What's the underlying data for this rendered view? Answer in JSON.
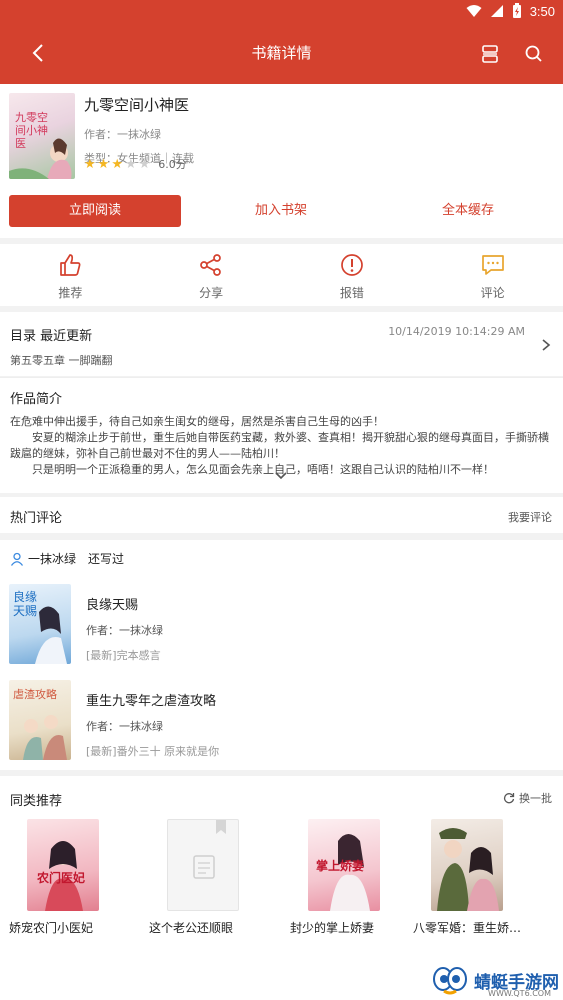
{
  "status_bar": {
    "time": "3:50"
  },
  "header": {
    "title": "书籍详情"
  },
  "book": {
    "title": "九零空间小神医",
    "author": "作者：一抹冰绿",
    "category": "类型：女生频道｜连载",
    "rating": {
      "filled": 3,
      "total": 5
    },
    "score": "6.0分",
    "cover_text": "九零空间小神医"
  },
  "buttons": {
    "read": "立即阅读",
    "add_shelf": "加入书架",
    "cache_all": "全本缓存"
  },
  "actions": [
    {
      "label": "推荐",
      "icon": "thumbs-up-icon"
    },
    {
      "label": "分享",
      "icon": "share-icon"
    },
    {
      "label": "报错",
      "icon": "error-icon"
    },
    {
      "label": "评论",
      "icon": "comment-icon"
    }
  ],
  "catalog": {
    "label": "目录  最近更新",
    "date": "10/14/2019 10:14:29 AM",
    "chapter": "第五零五章 一脚踹翻"
  },
  "intro": {
    "label": "作品简介",
    "lines": [
      "在危难中伸出援手，待自己如亲生闺女的继母，居然是杀害自己生母的凶手！",
      "　　安夏的糊涂止步于前世，重生后她自带医药宝藏，救外婆、查真相！揭开貌甜心狠的继母真面目，手撕骄横跋扈的继妹，弥补自己前世最对不住的男人——陆柏川！",
      "　　只是明明一个正派稳重的男人，怎么见面会先亲上自己，唔唔！这跟自己认识的陆柏川不一样！"
    ]
  },
  "hot_comments": {
    "label": "热门评论",
    "write": "我要评论"
  },
  "author_works": {
    "author_name": "一抹冰绿",
    "suffix": "还写过",
    "books": [
      {
        "title": "良缘天赐",
        "author": "作者：一抹冰绿",
        "chapter": "[最新]完本感言",
        "cover_text": "良缘天赐"
      },
      {
        "title": "重生九零年之虐渣攻略",
        "author": "作者：一抹冰绿",
        "chapter": "[最新]番外三十 原来就是你",
        "cover_text": "虐渣攻略"
      }
    ]
  },
  "similar": {
    "label": "同类推荐",
    "refresh": "换一批",
    "books": [
      {
        "title": "娇宠农门小医妃",
        "cover_text": "农门医妃"
      },
      {
        "title": "这个老公还顺眼",
        "cover_text": ""
      },
      {
        "title": "封少的掌上娇妻",
        "cover_text": "掌上娇妻"
      },
      {
        "title": "八零军婚：重生娇…",
        "cover_text": ""
      }
    ]
  },
  "watermark": {
    "text": "蜻蜓手游网",
    "sub": "WWW.QT6.COM"
  },
  "colors": {
    "brand": "#d4412e",
    "star": "#f5b722",
    "comment_icon": "#e8a52e",
    "user_icon": "#3d8be0"
  }
}
